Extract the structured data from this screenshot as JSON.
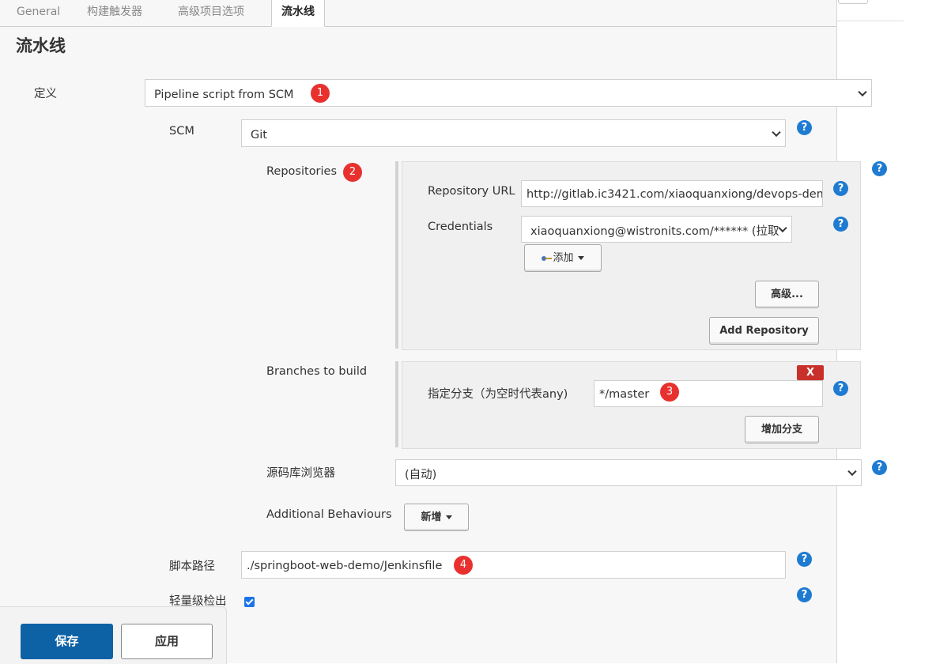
{
  "tabs": [
    "General",
    "构建触发器",
    "高级项目选项",
    "流水线"
  ],
  "section_title": "流水线",
  "definition": {
    "label": "定义",
    "value": "Pipeline script from SCM",
    "badge": "1"
  },
  "scm": {
    "label": "SCM",
    "value": "Git"
  },
  "repositories": {
    "label": "Repositories",
    "badge": "2",
    "url_label": "Repository URL",
    "url_value": "http://gitlab.ic3421.com/xiaoquanxiong/devops-dem",
    "credentials_label": "Credentials",
    "credentials_value": "xiaoquanxiong@wistronits.com/****** (拉取",
    "add_button": "添加",
    "advanced_button": "高级...",
    "add_repository_button": "Add Repository"
  },
  "branches": {
    "label": "Branches to build",
    "delete_button": "X",
    "spec_label": "指定分支（为空时代表any)",
    "spec_value": "*/master",
    "badge": "3",
    "add_branch_button": "增加分支"
  },
  "browser": {
    "label": "源码库浏览器",
    "value": "(自动)"
  },
  "behaviours": {
    "label": "Additional Behaviours",
    "add_button": "新增"
  },
  "script_path": {
    "label": "脚本路径",
    "value": "./springboot-web-demo/Jenkinsfile",
    "badge": "4"
  },
  "lightweight": {
    "label": "轻量级检出",
    "checked": true
  },
  "help_glyph": "?",
  "footer": {
    "save": "保存",
    "apply": "应用"
  },
  "colors": {
    "badge": "#e8312f",
    "help": "#1e7bd1",
    "save": "#0d62a6",
    "delete": "#c9302c"
  }
}
